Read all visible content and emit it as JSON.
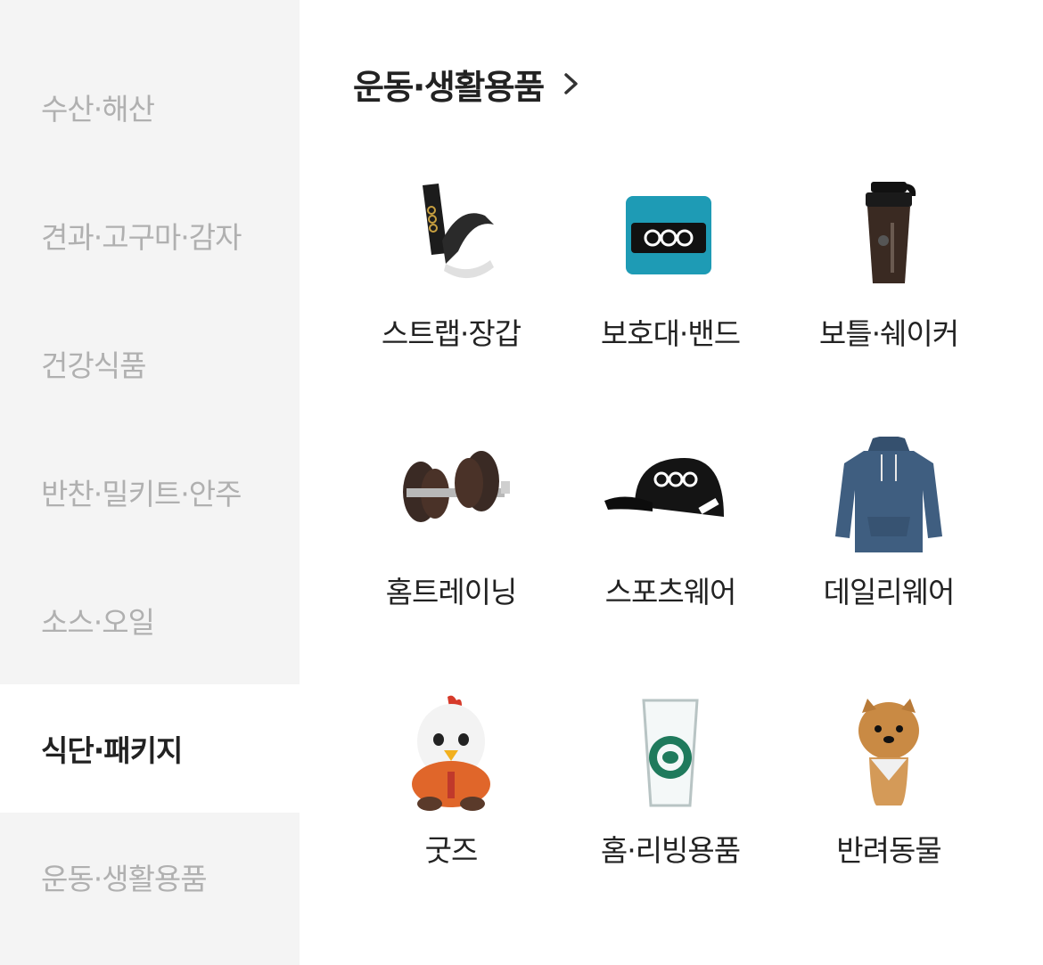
{
  "sidebar": {
    "items": [
      {
        "label": "수산·해산"
      },
      {
        "label": "견과·고구마·감자"
      },
      {
        "label": "건강식품"
      },
      {
        "label": "반찬·밀키트·안주"
      },
      {
        "label": "소스·오일"
      },
      {
        "label": "식단·패키지"
      },
      {
        "label": "운동·생활용품"
      }
    ],
    "active_index": 5
  },
  "main": {
    "title": "운동·생활용품",
    "categories": [
      {
        "label": "스트랩·장갑",
        "icon": "lifting-strap-icon"
      },
      {
        "label": "보호대·밴드",
        "icon": "wrist-band-icon"
      },
      {
        "label": "보틀·쉐이커",
        "icon": "shaker-bottle-icon"
      },
      {
        "label": "홈트레이닝",
        "icon": "dumbbell-icon"
      },
      {
        "label": "스포츠웨어",
        "icon": "cap-icon"
      },
      {
        "label": "데일리웨어",
        "icon": "hoodie-icon"
      },
      {
        "label": "굿즈",
        "icon": "chicken-plush-icon"
      },
      {
        "label": "홈·리빙용품",
        "icon": "glass-cup-icon"
      },
      {
        "label": "반려동물",
        "icon": "dog-icon"
      }
    ]
  },
  "colors": {
    "sidebar_bg": "#f4f4f4",
    "sidebar_text": "#b0b0b0",
    "active_text": "#222222",
    "wristband_teal": "#1e9bb5",
    "hoodie_blue": "#3f5e80"
  }
}
